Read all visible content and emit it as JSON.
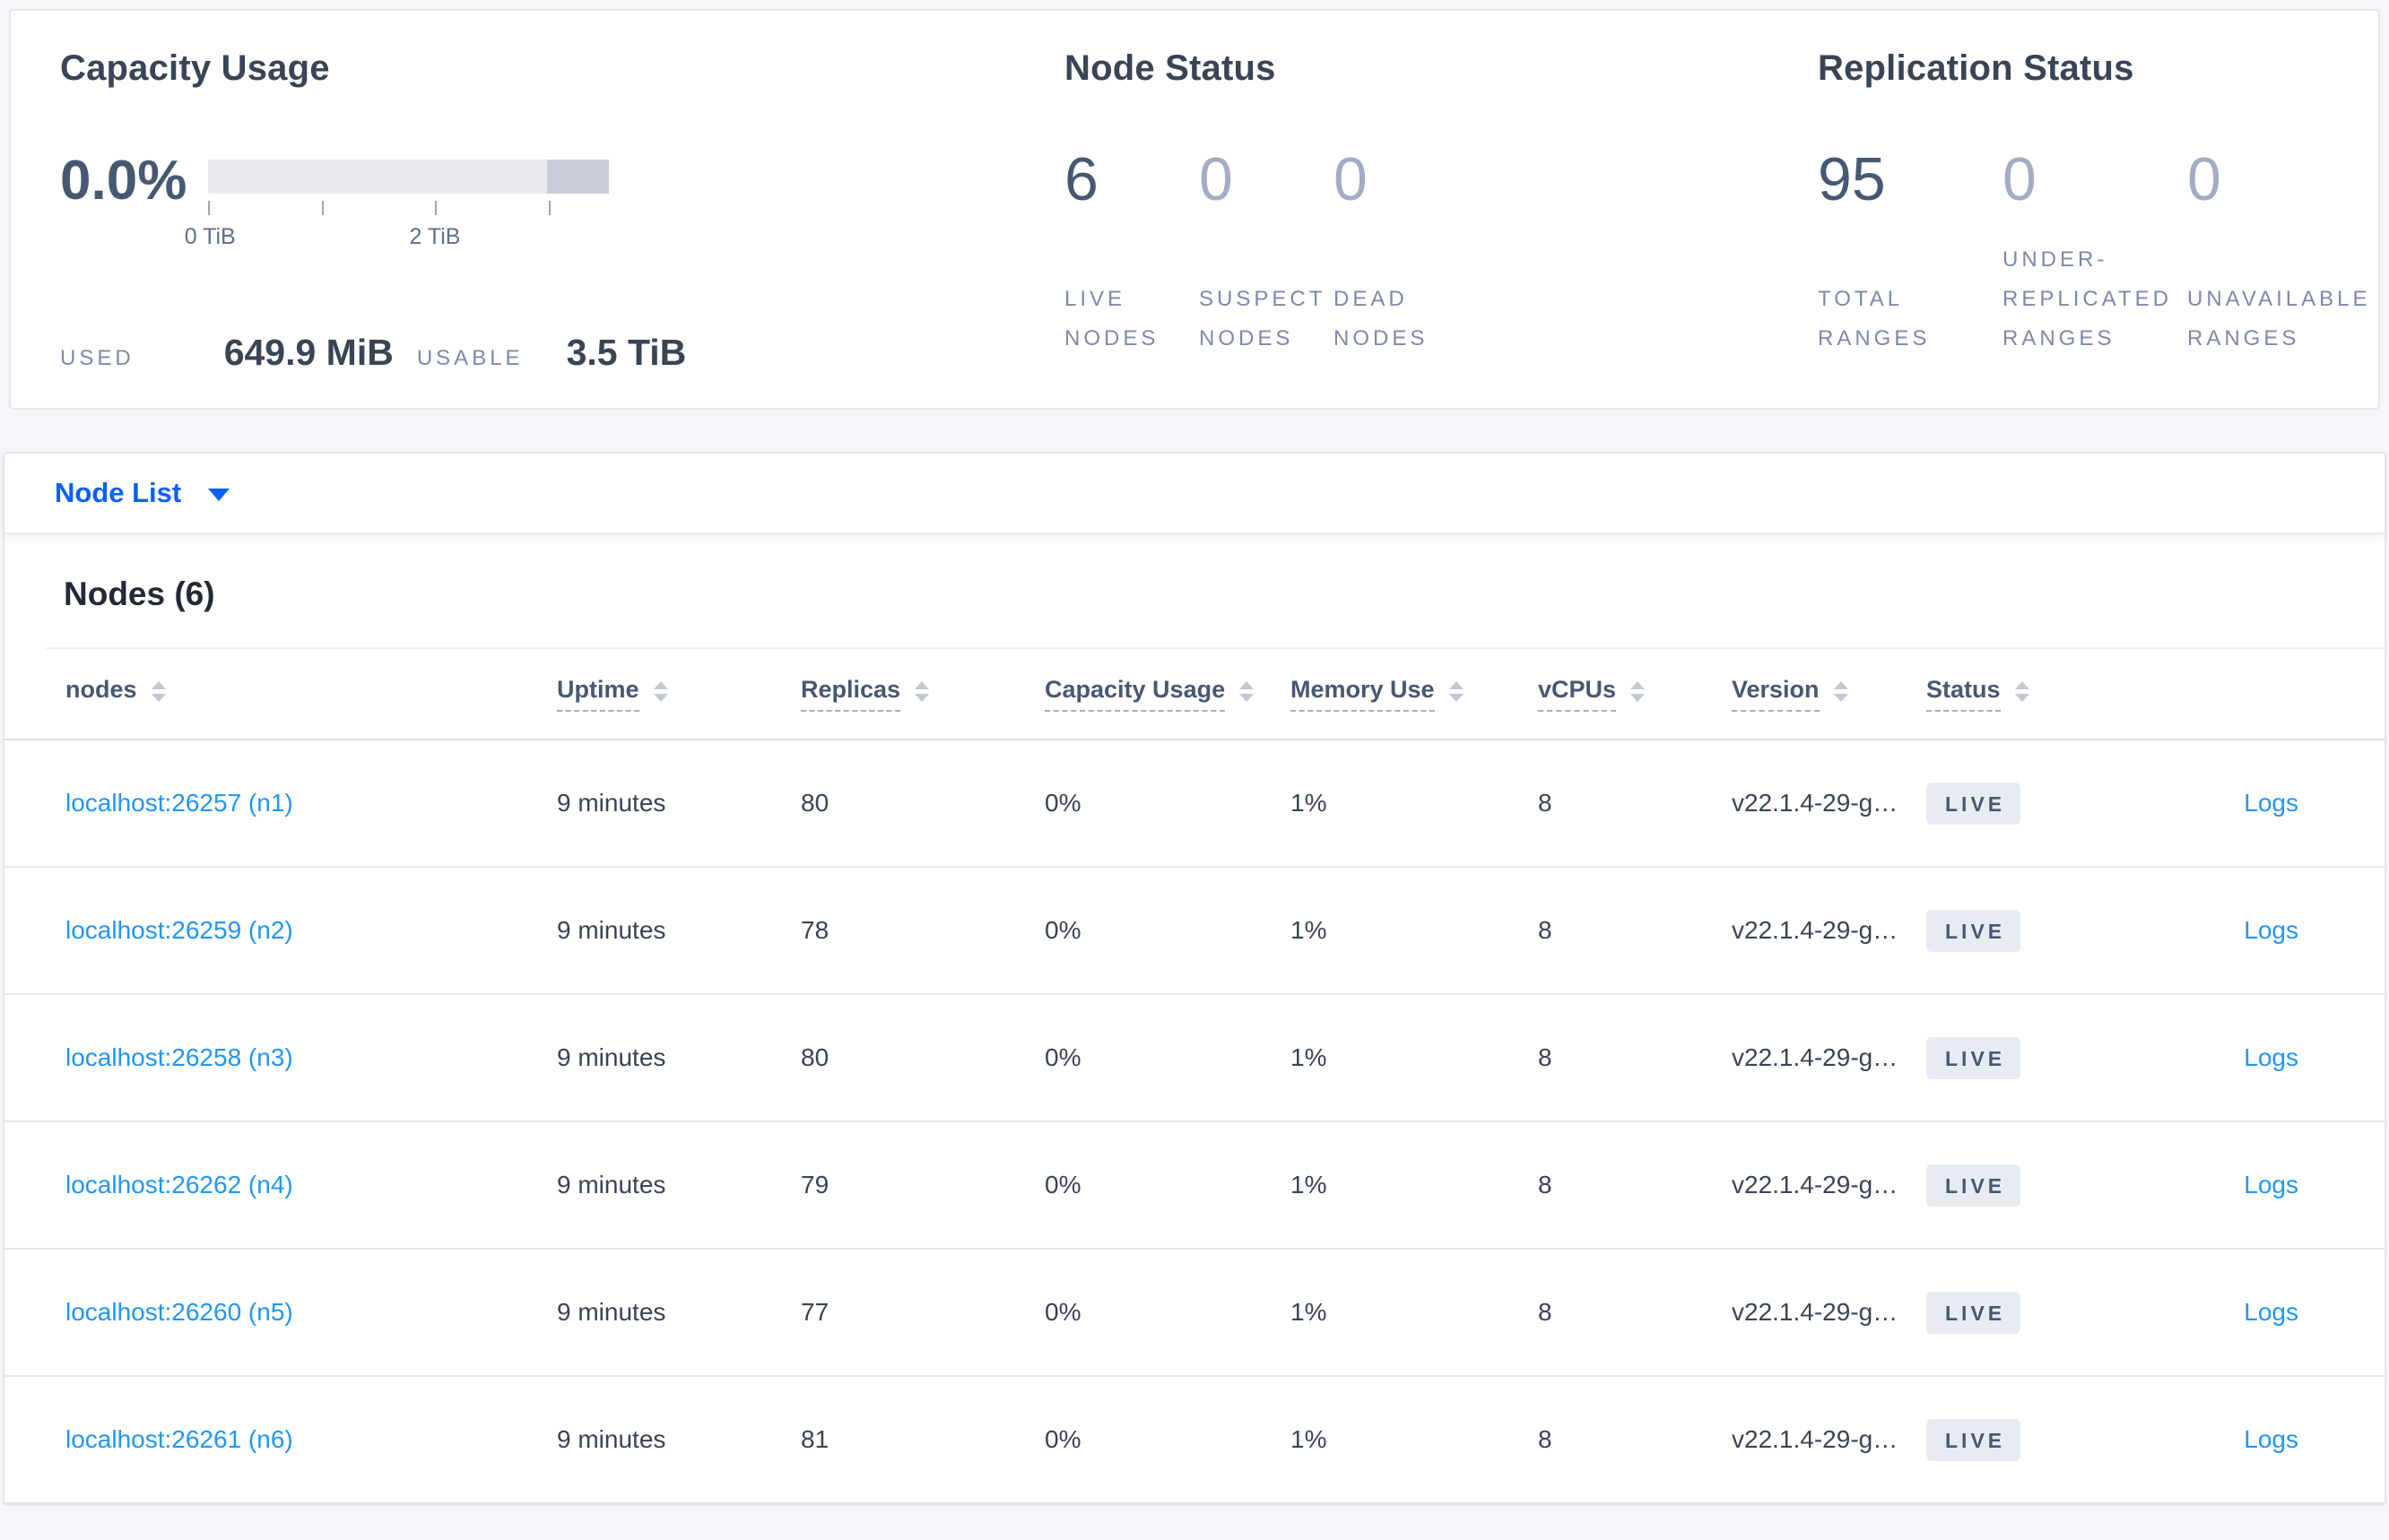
{
  "colors": {
    "page_background": "#f5f6fa",
    "link_blue": "#2196f3",
    "nav_link_blue": "#0b5fff",
    "badge_background": "#e7ecf3",
    "badge_text": "#475872",
    "bar_track": "#e7e9ef",
    "bar_segment": "#c9cdd8",
    "heading_text": "#394455",
    "muted_stat": "#a2adc5"
  },
  "summary": {
    "capacity": {
      "title": "Capacity Usage",
      "percent": "0.0%",
      "used_label": "USED",
      "used_value": "649.9 MiB",
      "usable_label": "USABLE",
      "usable_value": "3.5 TiB",
      "axis_ticks": [
        {
          "label": "0 TiB",
          "pct": 0
        },
        {
          "label": "",
          "pct": 28.3
        },
        {
          "label": "2 TiB",
          "pct": 56.6
        },
        {
          "label": "",
          "pct": 84.9
        }
      ]
    },
    "node_status": {
      "title": "Node Status",
      "stats": [
        {
          "value": "6",
          "label": "LIVE\nNODES",
          "muted": false
        },
        {
          "value": "0",
          "label": "SUSPECT\nNODES",
          "muted": true
        },
        {
          "value": "0",
          "label": "DEAD\nNODES",
          "muted": true
        }
      ]
    },
    "replication_status": {
      "title": "Replication Status",
      "stats": [
        {
          "value": "95",
          "label": "TOTAL\nRANGES",
          "muted": false
        },
        {
          "value": "0",
          "label": "UNDER-\nREPLICATED\nRANGES",
          "muted": true
        },
        {
          "value": "0",
          "label": "UNAVAILABLE\nRANGES",
          "muted": true
        }
      ]
    }
  },
  "nav": {
    "view_selector_label": "Node List"
  },
  "table": {
    "title": "Nodes (6)",
    "columns": [
      {
        "label": "nodes",
        "underlined": false
      },
      {
        "label": "Uptime",
        "underlined": true
      },
      {
        "label": "Replicas",
        "underlined": true
      },
      {
        "label": "Capacity Usage",
        "underlined": true
      },
      {
        "label": "Memory Use",
        "underlined": true
      },
      {
        "label": "vCPUs",
        "underlined": true
      },
      {
        "label": "Version",
        "underlined": true
      },
      {
        "label": "Status",
        "underlined": true
      }
    ],
    "rows": [
      {
        "node": "localhost:26257 (n1)",
        "uptime": "9 minutes",
        "replicas": "80",
        "capacity_usage": "0%",
        "memory_use": "1%",
        "vcpus": "8",
        "version": "v22.1.4-29-g…",
        "status": "LIVE",
        "logs_label": "Logs"
      },
      {
        "node": "localhost:26259 (n2)",
        "uptime": "9 minutes",
        "replicas": "78",
        "capacity_usage": "0%",
        "memory_use": "1%",
        "vcpus": "8",
        "version": "v22.1.4-29-g…",
        "status": "LIVE",
        "logs_label": "Logs"
      },
      {
        "node": "localhost:26258 (n3)",
        "uptime": "9 minutes",
        "replicas": "80",
        "capacity_usage": "0%",
        "memory_use": "1%",
        "vcpus": "8",
        "version": "v22.1.4-29-g…",
        "status": "LIVE",
        "logs_label": "Logs"
      },
      {
        "node": "localhost:26262 (n4)",
        "uptime": "9 minutes",
        "replicas": "79",
        "capacity_usage": "0%",
        "memory_use": "1%",
        "vcpus": "8",
        "version": "v22.1.4-29-g…",
        "status": "LIVE",
        "logs_label": "Logs"
      },
      {
        "node": "localhost:26260 (n5)",
        "uptime": "9 minutes",
        "replicas": "77",
        "capacity_usage": "0%",
        "memory_use": "1%",
        "vcpus": "8",
        "version": "v22.1.4-29-g…",
        "status": "LIVE",
        "logs_label": "Logs"
      },
      {
        "node": "localhost:26261 (n6)",
        "uptime": "9 minutes",
        "replicas": "81",
        "capacity_usage": "0%",
        "memory_use": "1%",
        "vcpus": "8",
        "version": "v22.1.4-29-g…",
        "status": "LIVE",
        "logs_label": "Logs"
      }
    ]
  }
}
